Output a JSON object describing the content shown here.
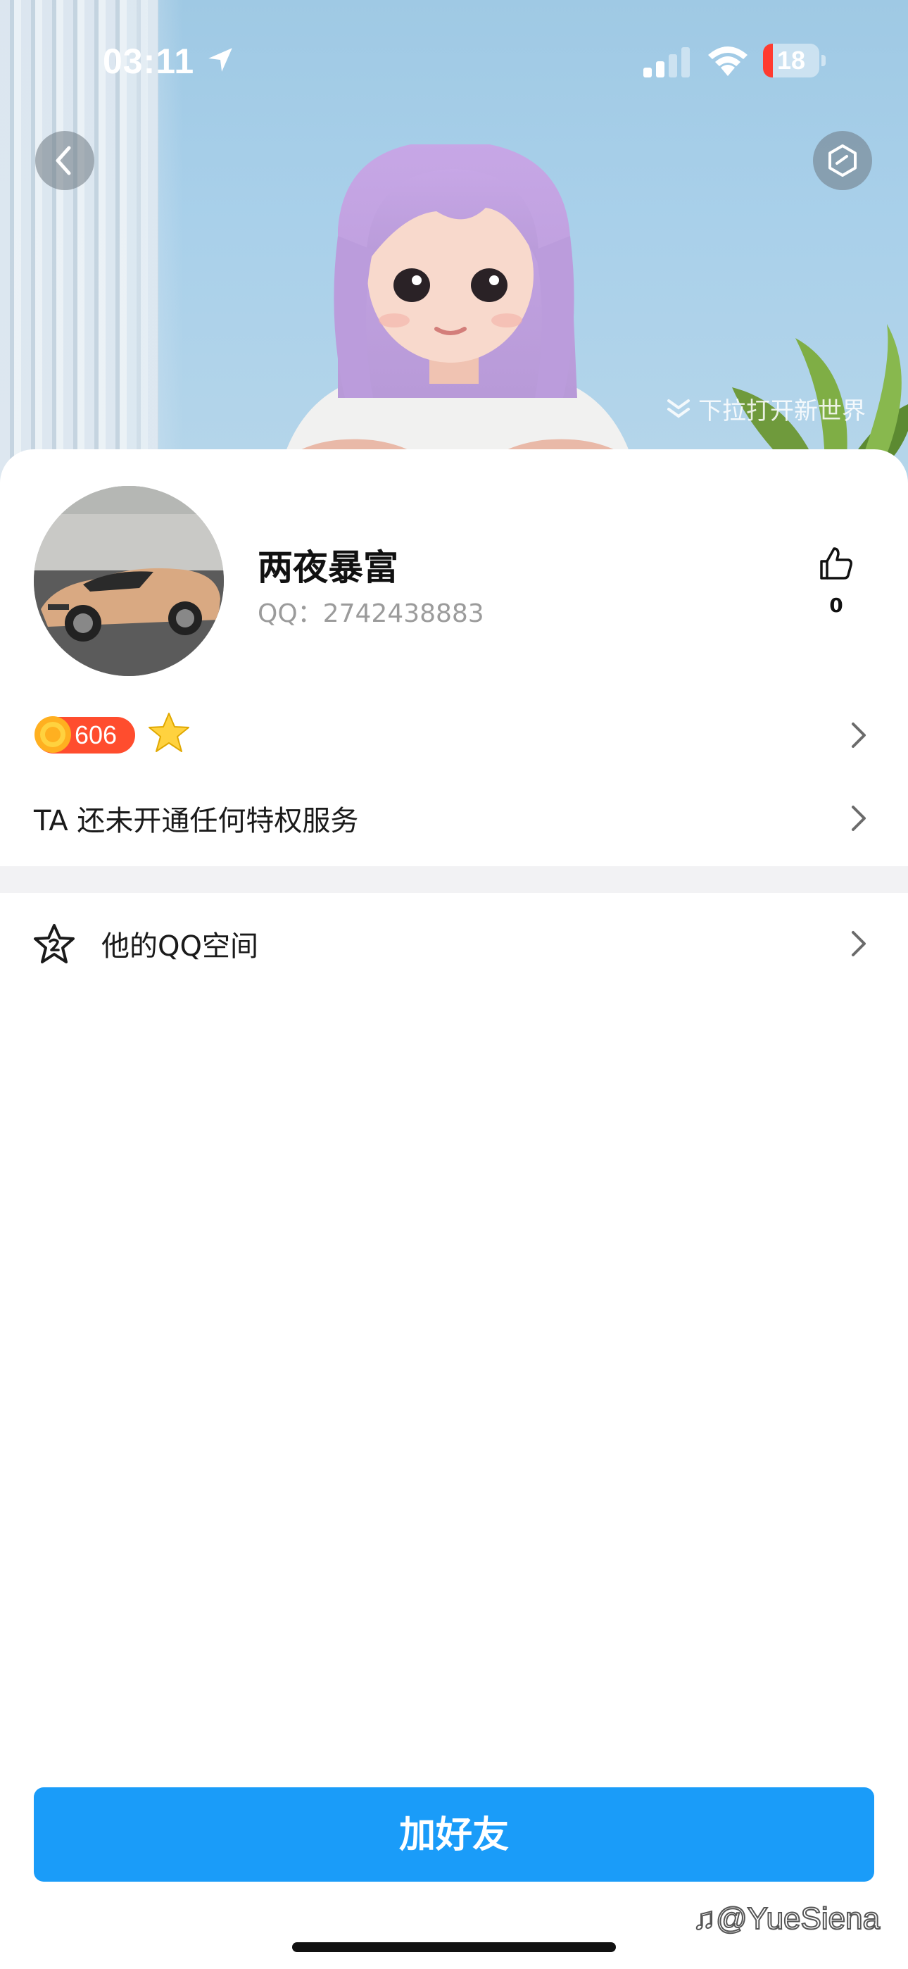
{
  "status_bar": {
    "time": "03:11",
    "battery_level": "18",
    "battery_fraction": 0.18
  },
  "header": {
    "pull_hint": "下拉打开新世界",
    "back_icon": "chevron-left-icon",
    "settings_icon": "hexagon-settings-icon"
  },
  "profile": {
    "name": "两夜暴富",
    "qq_label": "QQ：2742438883",
    "like_count": "0"
  },
  "level": {
    "coin_value": "606"
  },
  "privilege": {
    "text": "TA 还未开通任何特权服务"
  },
  "qzone": {
    "label": "他的QQ空间",
    "icon": "star-2-icon"
  },
  "actions": {
    "add_friend": "加好友"
  },
  "watermark": {
    "text": "@YueSiena"
  },
  "colors": {
    "primary_button": "#1a9cf9",
    "coin_badge": "#ff4d2e",
    "battery_low": "#ff3b30",
    "divider": "#f2f2f4"
  }
}
